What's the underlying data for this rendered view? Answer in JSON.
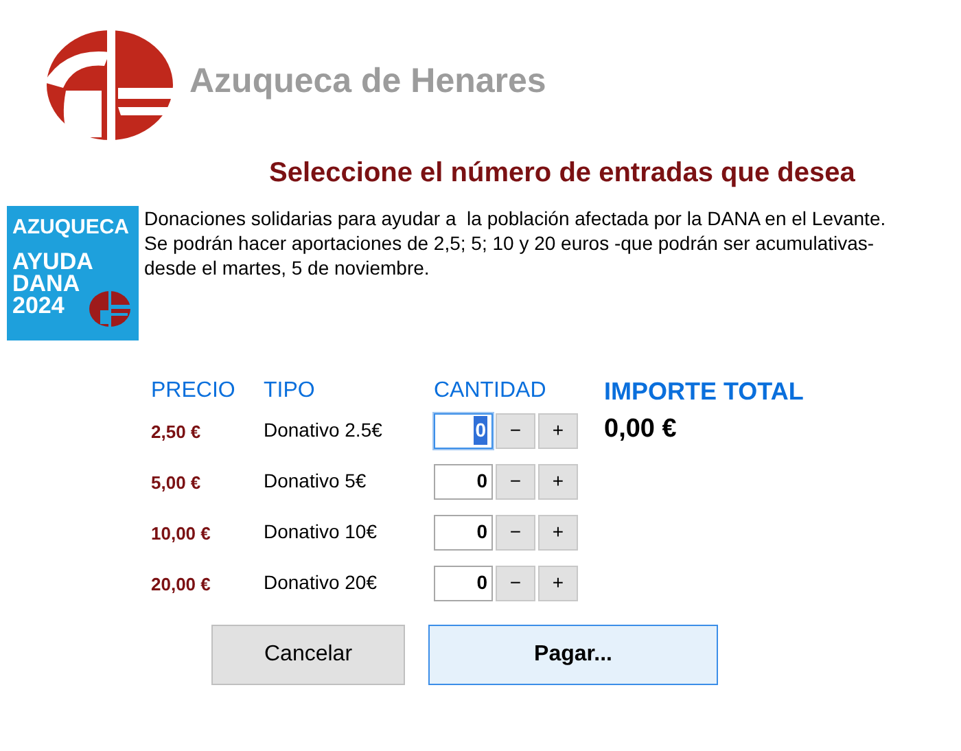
{
  "brand": {
    "name": "Azuqueca de Henares"
  },
  "title": "Seleccione el número de entradas que desea",
  "badge": {
    "lines": [
      "AZUQUECA",
      "AYUDA",
      "DANA",
      "2024"
    ]
  },
  "description": "Donaciones solidarias para ayudar a  la población afectada por la DANA en el Levante. Se podrán hacer aportaciones de 2,5; 5; 10 y 20 euros -que podrán ser acumulativas- desde el martes, 5 de noviembre.",
  "columns": [
    "PRECIO",
    "TIPO",
    "CANTIDAD"
  ],
  "total": {
    "label": "IMPORTE TOTAL",
    "value": "0,00 €"
  },
  "rows": [
    {
      "price": "2,50 €",
      "type": "Donativo 2.5€",
      "quantity": "0",
      "focused": true,
      "minus": "−",
      "plus": "+"
    },
    {
      "price": "5,00 €",
      "type": "Donativo 5€",
      "quantity": "0",
      "focused": false,
      "minus": "−",
      "plus": "+"
    },
    {
      "price": "10,00 €",
      "type": "Donativo 10€",
      "quantity": "0",
      "focused": false,
      "minus": "−",
      "plus": "+"
    },
    {
      "price": "20,00 €",
      "type": "Donativo 20€",
      "quantity": "0",
      "focused": false,
      "minus": "−",
      "plus": "+"
    }
  ],
  "buttons": [
    {
      "label": "Cancelar",
      "kind": "secondary"
    },
    {
      "label": "Pagar...",
      "kind": "primary"
    }
  ]
}
